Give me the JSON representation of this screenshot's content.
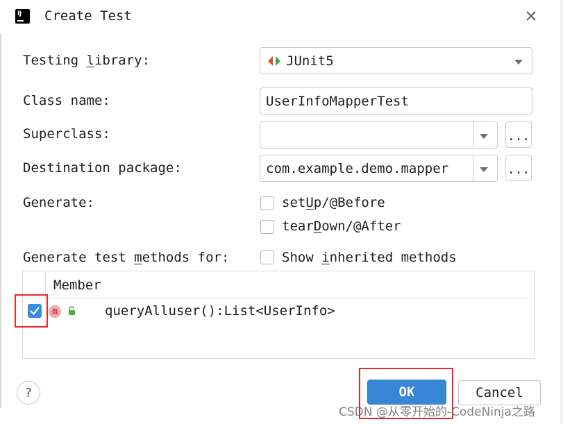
{
  "window": {
    "title": "Create Test",
    "app_icon": "intellij-idea-icon",
    "close_icon": "close-icon"
  },
  "form": {
    "testing_library": {
      "label_prefix": "Testing ",
      "label_mnemonic": "l",
      "label_suffix": "ibrary:",
      "value": "JUnit5",
      "icon": "junit-icon"
    },
    "class_name": {
      "label": "Class name:",
      "value": "UserInfoMapperTest"
    },
    "superclass": {
      "label": "Superclass:",
      "value": "",
      "browse_label": "..."
    },
    "destination_package": {
      "label": "Destination package:",
      "value": "com.example.demo.mapper",
      "browse_label": "..."
    },
    "generate": {
      "label": "Generate:",
      "setup": {
        "prefix": "set",
        "mnemonic": "U",
        "suffix": "p/@Before",
        "checked": false
      },
      "teardown": {
        "prefix": "tear",
        "mnemonic": "D",
        "suffix": "own/@After",
        "checked": false
      }
    },
    "methods_for": {
      "label_prefix": "Generate test ",
      "label_mnemonic": "m",
      "label_suffix": "ethods for:",
      "show_inherited": {
        "prefix": "Show ",
        "mnemonic": "i",
        "suffix": "nherited methods",
        "checked": false
      }
    }
  },
  "members_table": {
    "header": "Member",
    "rows": [
      {
        "checked": true,
        "icon": "method-icon",
        "icon_letter": "m",
        "access_icon": "public-lock-icon",
        "signature": "queryAlluser():List<UserInfo>"
      }
    ]
  },
  "footer": {
    "help_label": "?",
    "ok_label": "OK",
    "cancel_label": "Cancel"
  },
  "watermark": "CSDN @从零开始的-CodeNinja之路",
  "colors": {
    "accent": "#3a86d6",
    "checkbox_checked": "#3c8be2",
    "highlight_red": "#e8262b",
    "border": "#c9c9c9"
  }
}
